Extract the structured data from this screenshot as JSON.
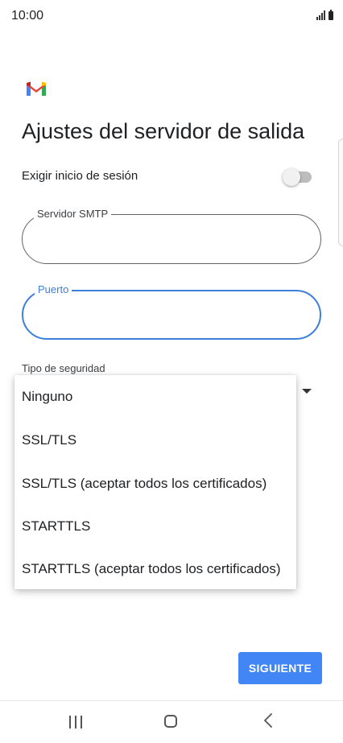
{
  "status_bar": {
    "time": "10:00",
    "icons": [
      "signal-icon",
      "battery-icon"
    ]
  },
  "app": {
    "logo": "gmail-logo",
    "colors": {
      "red": "#ea4335",
      "blue": "#4285f4",
      "green": "#34a853",
      "yellow": "#fbbc04"
    }
  },
  "page": {
    "title": "Ajustes del servidor de salida"
  },
  "login_toggle": {
    "label": "Exigir inicio de sesión",
    "enabled": false
  },
  "smtp_field": {
    "label": "Servidor SMTP",
    "value": ""
  },
  "port_field": {
    "label": "Puerto",
    "value": "",
    "focused": true
  },
  "security": {
    "label": "Tipo de seguridad",
    "options": [
      "Ninguno",
      "SSL/TLS",
      "SSL/TLS (aceptar todos los certificados)",
      "STARTTLS",
      "STARTTLS (aceptar todos los certificados)"
    ]
  },
  "actions": {
    "next_label": "SIGUIENTE",
    "accent": "#4285f4"
  },
  "nav_bar": {
    "icons": [
      "recent-apps-icon",
      "home-icon",
      "back-icon"
    ]
  }
}
